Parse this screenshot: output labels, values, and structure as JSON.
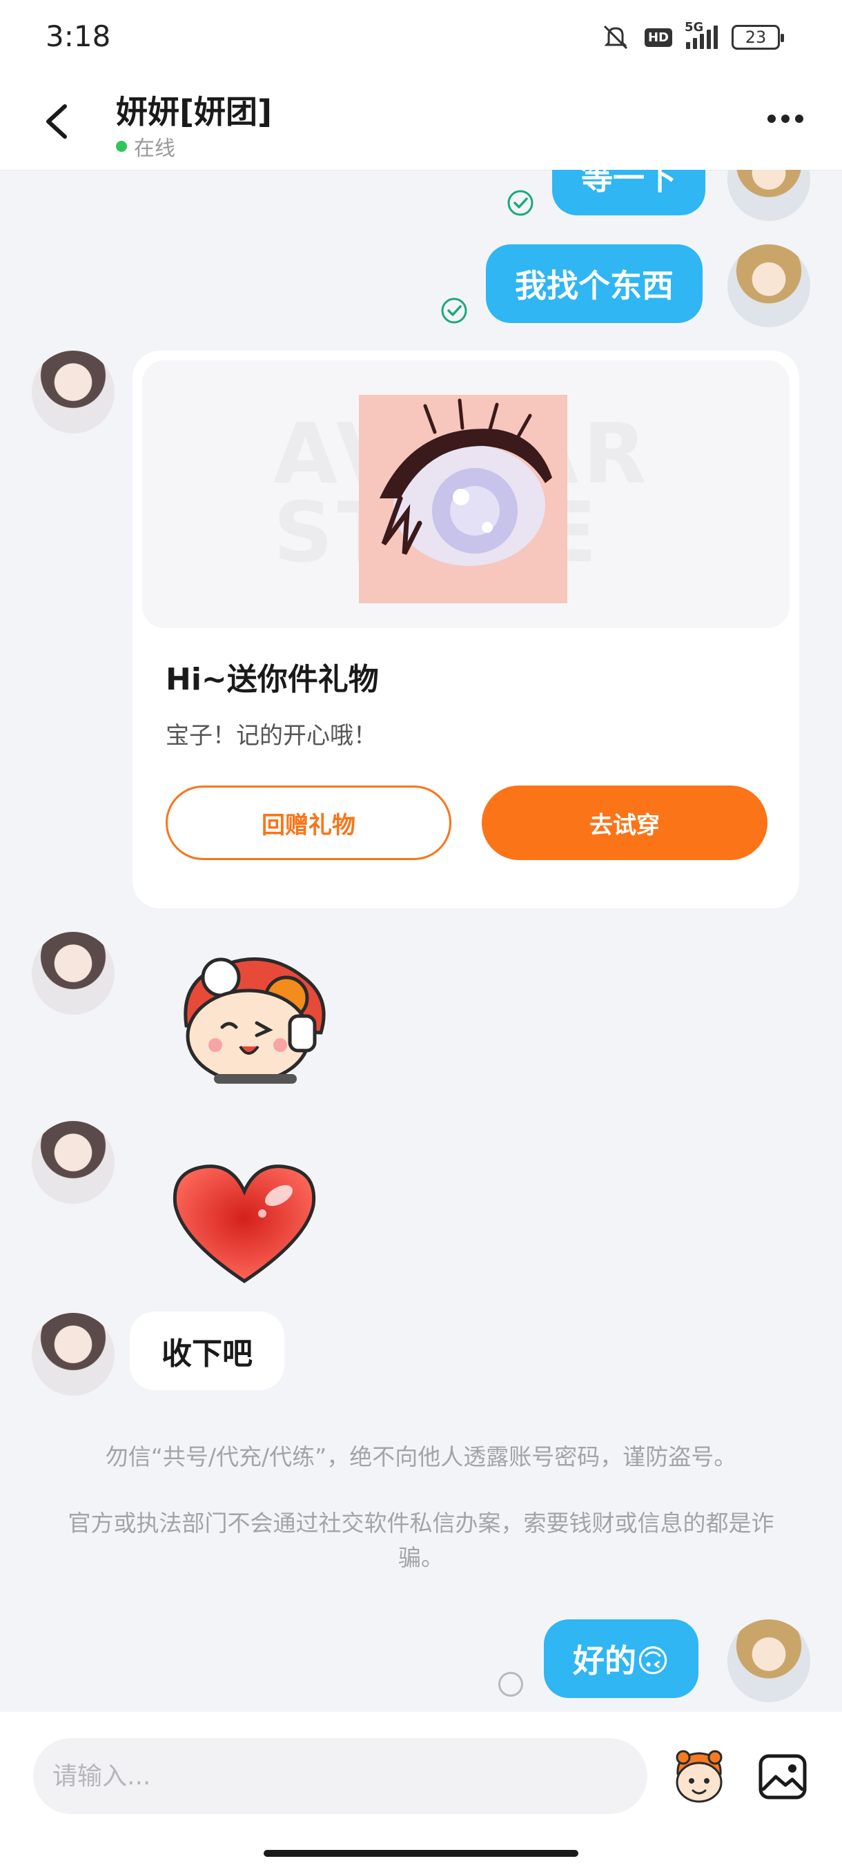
{
  "status_bar": {
    "time": "3:18",
    "network": "5G",
    "hd_badge": "HD",
    "battery": "23"
  },
  "header": {
    "contact_name": "妍妍[妍团]",
    "presence": "在线"
  },
  "messages": {
    "m1_text": "等一下",
    "m2_text": "我找个东西",
    "gift": {
      "watermark": "AVATAR\nSTORE",
      "title": "Hi~送你件礼物",
      "desc": "宝子！记的开心哦！",
      "return_button": "回赠礼物",
      "try_button": "去试穿"
    },
    "m6_text": "收下吧",
    "last_text": "好的🙃"
  },
  "notices": {
    "line1": "勿信“共号/代充/代练”，绝不向他人透露账号密码，谨防盗号。",
    "line2": "官方或执法部门不会通过社交软件私信办案，索要钱财或信息的都是诈骗。"
  },
  "input": {
    "placeholder": "请输入..."
  },
  "colors": {
    "accent_blue": "#2fb6f3",
    "accent_orange": "#fb7418",
    "online_green": "#31c55a",
    "read_green": "#1aa97a"
  },
  "icons": [
    "back-arrow-icon",
    "more-icon",
    "read-check-icon",
    "pending-circle-icon",
    "emoji-sticker-icon",
    "image-icon"
  ]
}
